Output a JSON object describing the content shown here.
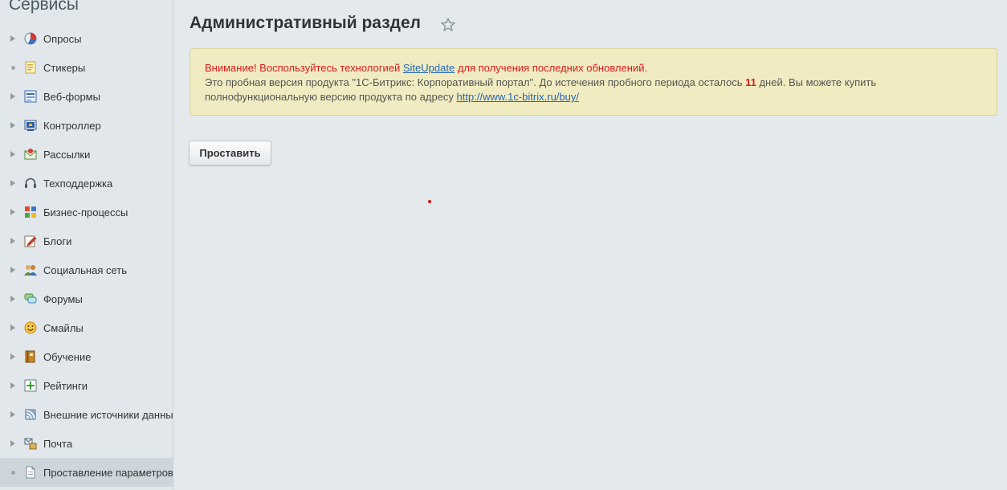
{
  "sidebar": {
    "title": "Сервисы",
    "items": [
      {
        "label": "Опросы",
        "icon": "poll-icon",
        "marker": "arrow"
      },
      {
        "label": "Стикеры",
        "icon": "sticker-icon",
        "marker": "dot"
      },
      {
        "label": "Веб-формы",
        "icon": "webform-icon",
        "marker": "arrow"
      },
      {
        "label": "Контроллер",
        "icon": "controller-icon",
        "marker": "arrow"
      },
      {
        "label": "Рассылки",
        "icon": "mailing-icon",
        "marker": "arrow"
      },
      {
        "label": "Техподдержка",
        "icon": "headset-icon",
        "marker": "arrow"
      },
      {
        "label": "Бизнес-процессы",
        "icon": "workflow-icon",
        "marker": "arrow"
      },
      {
        "label": "Блоги",
        "icon": "blog-icon",
        "marker": "arrow"
      },
      {
        "label": "Социальная сеть",
        "icon": "social-icon",
        "marker": "arrow"
      },
      {
        "label": "Форумы",
        "icon": "forum-icon",
        "marker": "arrow"
      },
      {
        "label": "Смайлы",
        "icon": "smiley-icon",
        "marker": "arrow"
      },
      {
        "label": "Обучение",
        "icon": "learning-icon",
        "marker": "arrow"
      },
      {
        "label": "Рейтинги",
        "icon": "rating-icon",
        "marker": "arrow"
      },
      {
        "label": "Внешние источники данных",
        "icon": "rss-icon",
        "marker": "arrow"
      },
      {
        "label": "Почта",
        "icon": "mail-icon",
        "marker": "arrow"
      },
      {
        "label": "Проставление параметров",
        "icon": "document-icon",
        "marker": "dot",
        "active": true
      }
    ]
  },
  "header": {
    "title": "Административный раздел",
    "favorite_icon": "star-icon"
  },
  "notice": {
    "warning_prefix": "Внимание! Воспользуйтесь технологией ",
    "link_siteupdate": "SiteUpdate",
    "warning_suffix": " для получения последних обновлений.",
    "trial_prefix": "Это пробная версия продукта \"1С-Битрикс: Корпоративный портал\". До истечения пробного периода осталось ",
    "days_left": "11",
    "trial_suffix": " дней. Вы можете купить",
    "buy_text": "полнофункциональную версию продукта по адресу ",
    "buy_link": "http://www.1c-bitrix.ru/buy/"
  },
  "actions": {
    "apply_label": "Проставить"
  },
  "colors": {
    "warning": "#d91a1a",
    "link": "#2067b0",
    "notice_bg": "#f1ebc1"
  }
}
